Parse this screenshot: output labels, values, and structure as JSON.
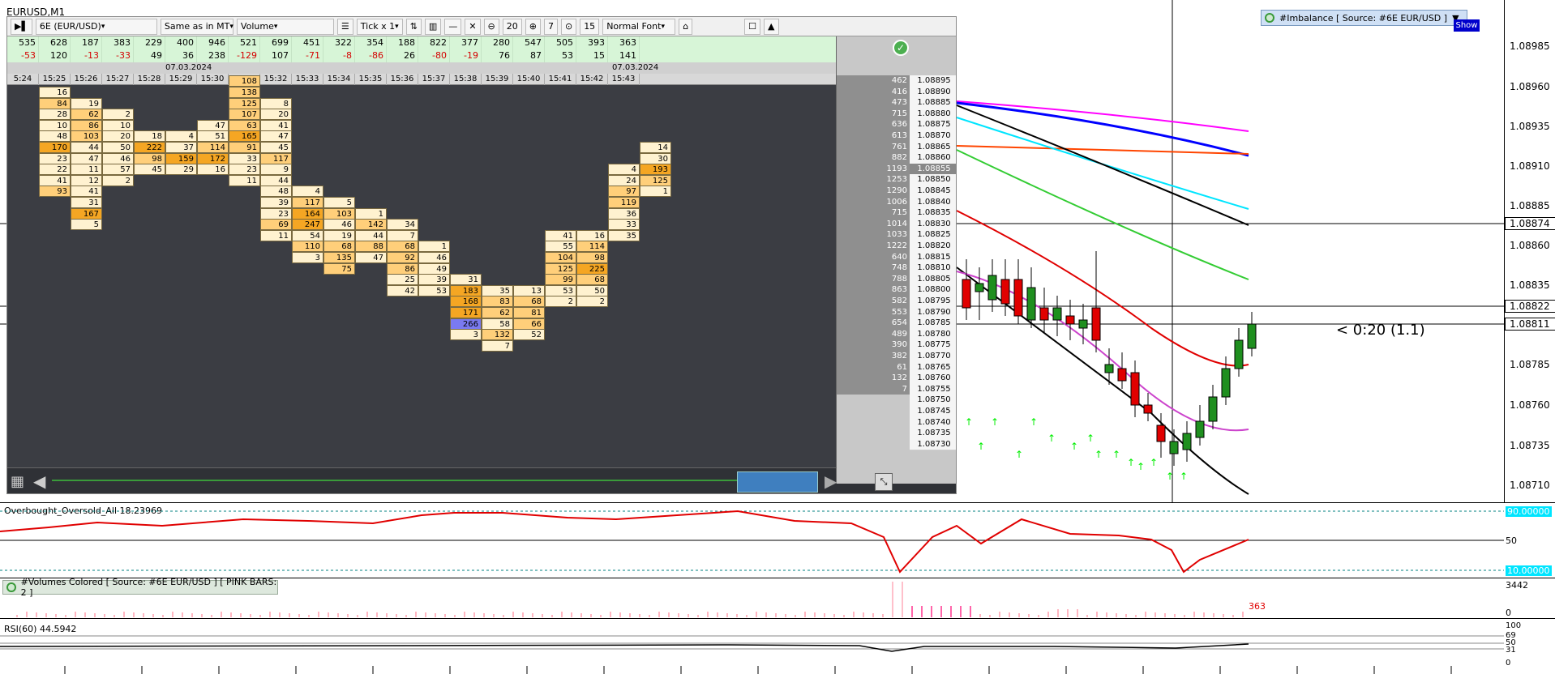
{
  "chart": {
    "title": "EURUSD,M1"
  },
  "toolbar": {
    "symbol": "6E (EUR/USD)",
    "mode": "Same as in MT",
    "type": "Volume",
    "tick": "Tick x 1",
    "num1": "20",
    "num2": "7",
    "num3": "15",
    "font": "Normal Font"
  },
  "stats": {
    "row1": [
      "535",
      "628",
      "187",
      "383",
      "229",
      "400",
      "946",
      "521",
      "699",
      "451",
      "322",
      "354",
      "188",
      "822",
      "377",
      "280",
      "547",
      "505",
      "393",
      "363"
    ],
    "row2": [
      "-53",
      "120",
      "-13",
      "-33",
      "49",
      "36",
      "238",
      "-129",
      "107",
      "-71",
      "-8",
      "-86",
      "26",
      "-80",
      "-19",
      "76",
      "87",
      "53",
      "15",
      "141"
    ]
  },
  "dates": [
    "07.03.2024",
    "07.03.2024"
  ],
  "times": [
    "5:24",
    "15:25",
    "15:26",
    "15:27",
    "15:28",
    "15:29",
    "15:30",
    "15:31",
    "15:32",
    "15:33",
    "15:34",
    "15:35",
    "15:36",
    "15:37",
    "15:38",
    "15:39",
    "15:40",
    "15:41",
    "15:42",
    "15:43"
  ],
  "ladder": {
    "vols": [
      "462",
      "416",
      "473",
      "715",
      "636",
      "613",
      "761",
      "882",
      "1193",
      "1253",
      "1290",
      "1006",
      "715",
      "1014",
      "1033",
      "1222",
      "640",
      "748",
      "788",
      "863",
      "582",
      "553",
      "654",
      "489",
      "390",
      "382",
      "61",
      "132",
      "7",
      "",
      "",
      "",
      "",
      ""
    ],
    "prices": [
      "1.08895",
      "1.08890",
      "1.08885",
      "1.08880",
      "1.08875",
      "1.08870",
      "1.08865",
      "1.08860",
      "1.08855",
      "1.08850",
      "1.08845",
      "1.08840",
      "1.08835",
      "1.08830",
      "1.08825",
      "1.08820",
      "1.08815",
      "1.08810",
      "1.08805",
      "1.08800",
      "1.08795",
      "1.08790",
      "1.08785",
      "1.08780",
      "1.08775",
      "1.08770",
      "1.08765",
      "1.08760",
      "1.08755",
      "1.08750",
      "1.08745",
      "1.08740",
      "1.08735",
      "1.08730"
    ]
  },
  "price_axis": {
    "labels": [
      "1.08985",
      "1.08960",
      "1.08935",
      "1.08910",
      "1.08885",
      "1.08860",
      "1.08835",
      "1.08785",
      "1.08760",
      "1.08735",
      "1.08710"
    ],
    "boxes": [
      "1.08874",
      "1.08822",
      "1.08811"
    ]
  },
  "imbalance": {
    "label": "#Imbalance [ Source: #6E EUR/USD ]",
    "show": "Show"
  },
  "timer": "< 0:20 (1.1)",
  "oscillator": {
    "title": "Overbought_Oversold_All 18.23969",
    "hi": "90.00000",
    "mid": "50",
    "lo": "10.00000"
  },
  "volumes": {
    "title": "#Volumes Colored [ Source: #6E EUR/USD ]  [ PINK BARS: 2 ]",
    "max": "3442",
    "zero": "0",
    "last": "363"
  },
  "rsi": {
    "title": "RSI(60) 44.5942",
    "l100": "100",
    "l69": "69",
    "l50": "50",
    "l31": "31",
    "l0": "0"
  },
  "colors": {
    "up": "#1f8f1f",
    "down": "#e00000",
    "accent": "#ffb347"
  }
}
